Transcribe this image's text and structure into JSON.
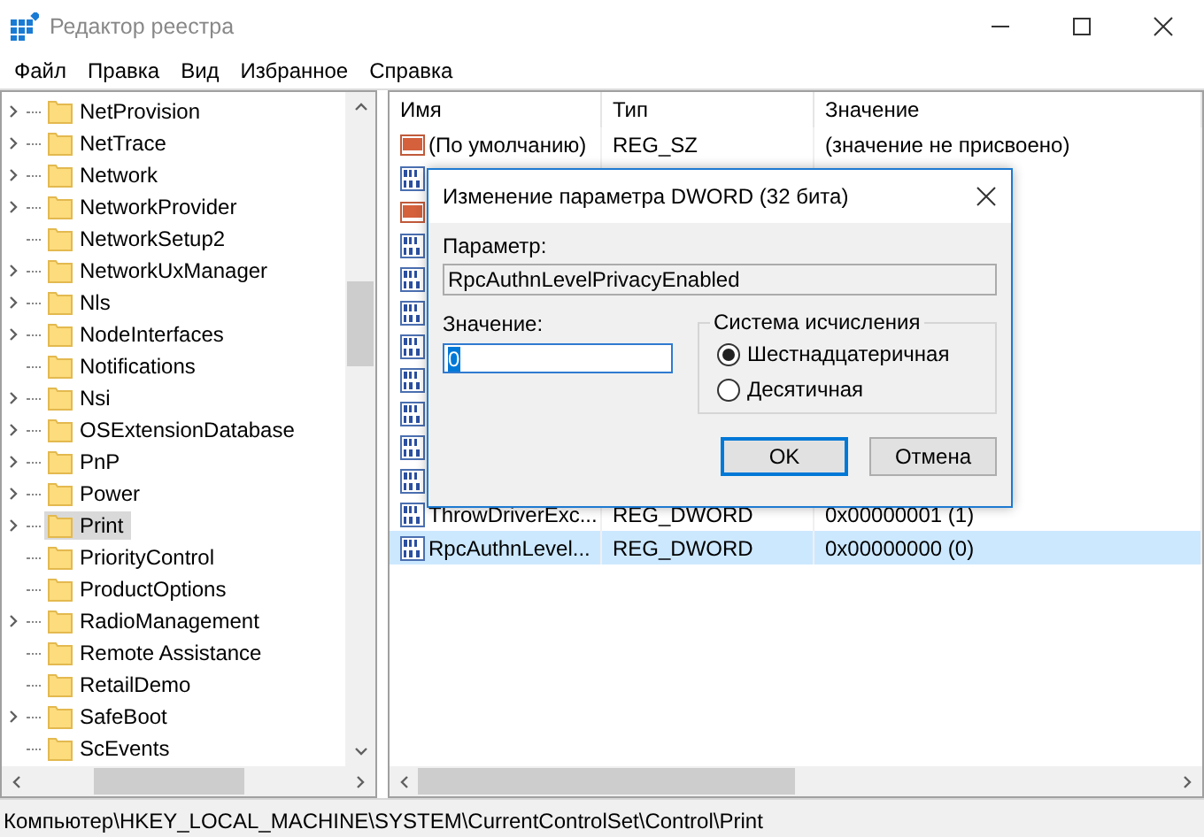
{
  "window": {
    "title": "Редактор реестра"
  },
  "menu": [
    "Файл",
    "Правка",
    "Вид",
    "Избранное",
    "Справка"
  ],
  "tree": {
    "items": [
      {
        "label": "NetProvision",
        "expandable": true,
        "selected": false
      },
      {
        "label": "NetTrace",
        "expandable": true,
        "selected": false
      },
      {
        "label": "Network",
        "expandable": true,
        "selected": false
      },
      {
        "label": "NetworkProvider",
        "expandable": true,
        "selected": false
      },
      {
        "label": "NetworkSetup2",
        "expandable": false,
        "selected": false
      },
      {
        "label": "NetworkUxManager",
        "expandable": true,
        "selected": false
      },
      {
        "label": "Nls",
        "expandable": true,
        "selected": false
      },
      {
        "label": "NodeInterfaces",
        "expandable": true,
        "selected": false
      },
      {
        "label": "Notifications",
        "expandable": false,
        "selected": false
      },
      {
        "label": "Nsi",
        "expandable": true,
        "selected": false
      },
      {
        "label": "OSExtensionDatabase",
        "expandable": true,
        "selected": false
      },
      {
        "label": "PnP",
        "expandable": true,
        "selected": false
      },
      {
        "label": "Power",
        "expandable": true,
        "selected": false
      },
      {
        "label": "Print",
        "expandable": true,
        "selected": true
      },
      {
        "label": "PriorityControl",
        "expandable": false,
        "selected": false
      },
      {
        "label": "ProductOptions",
        "expandable": false,
        "selected": false
      },
      {
        "label": "RadioManagement",
        "expandable": true,
        "selected": false
      },
      {
        "label": "Remote Assistance",
        "expandable": false,
        "selected": false
      },
      {
        "label": "RetailDemo",
        "expandable": false,
        "selected": false
      },
      {
        "label": "SafeBoot",
        "expandable": true,
        "selected": false
      },
      {
        "label": "ScEvents",
        "expandable": false,
        "selected": false
      }
    ]
  },
  "table": {
    "columns": [
      "Имя",
      "Тип",
      "Значение"
    ],
    "rows": [
      {
        "kind": "string",
        "name": "(По умолчанию)",
        "type": "REG_SZ",
        "value": "(значение не присвоено)",
        "selected": false
      },
      {
        "kind": "binary",
        "selected": false
      },
      {
        "kind": "string",
        "selected": false
      },
      {
        "kind": "binary",
        "selected": false
      },
      {
        "kind": "binary",
        "selected": false
      },
      {
        "kind": "binary",
        "selected": false
      },
      {
        "kind": "binary",
        "selected": false
      },
      {
        "kind": "binary",
        "selected": false
      },
      {
        "kind": "binary",
        "selected": false
      },
      {
        "kind": "binary",
        "selected": false
      },
      {
        "kind": "binary",
        "selected": false
      },
      {
        "kind": "binary",
        "name": "ThrowDriverExc...",
        "type": "REG_DWORD",
        "value": "0x00000001 (1)",
        "selected": false
      },
      {
        "kind": "binary",
        "name": "RpcAuthnLevel...",
        "type": "REG_DWORD",
        "value": "0x00000000 (0)",
        "selected": true
      }
    ]
  },
  "dialog": {
    "title": "Изменение параметра DWORD (32 бита)",
    "param_label": "Параметр:",
    "param_value": "RpcAuthnLevelPrivacyEnabled",
    "value_label": "Значение:",
    "value": "0",
    "group_title": "Система исчисления",
    "radios": [
      {
        "label": "Шестнадцатеричная",
        "selected": true
      },
      {
        "label": "Десятичная",
        "selected": false
      }
    ],
    "buttons": [
      {
        "label": "OK",
        "default": true
      },
      {
        "label": "Отмена",
        "default": false
      }
    ]
  },
  "status_bar": "Компьютер\\HKEY_LOCAL_MACHINE\\SYSTEM\\CurrentControlSet\\Control\\Print"
}
